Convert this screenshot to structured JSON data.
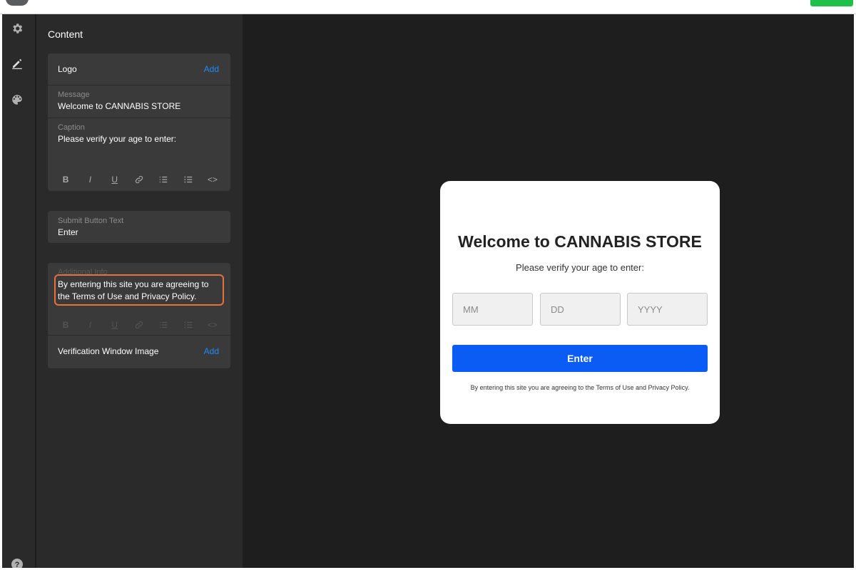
{
  "colors": {
    "accent": "#1d8cf8",
    "button": "#0a5cf5",
    "highlight": "#e8703a",
    "status_green": "#1ec04a"
  },
  "rail": {
    "icons": [
      {
        "name": "settings",
        "icon": "gear-icon"
      },
      {
        "name": "content",
        "icon": "pencil-icon"
      },
      {
        "name": "theme",
        "icon": "palette-icon"
      },
      {
        "name": "help",
        "icon": "help-icon"
      }
    ],
    "help_glyph": "?"
  },
  "panel": {
    "title": "Content",
    "logo": {
      "label": "Logo",
      "action": "Add"
    },
    "message": {
      "label": "Message",
      "value": "Welcome to CANNABIS STORE"
    },
    "caption": {
      "label": "Caption",
      "value": "Please verify your age to enter:"
    },
    "submit": {
      "label": "Submit Button Text",
      "value": "Enter"
    },
    "additional": {
      "label": "Additional Info",
      "value": "By entering this site you are agreeing to the Terms of Use and Privacy Policy."
    },
    "window_image": {
      "label": "Verification Window Image",
      "action": "Add"
    },
    "toolbar": {
      "bold": "B",
      "italic": "I",
      "underline": "U",
      "code": "<>"
    }
  },
  "preview": {
    "title": "Welcome to CANNABIS STORE",
    "caption": "Please verify your age to enter:",
    "fields": [
      {
        "placeholder": "MM"
      },
      {
        "placeholder": "DD"
      },
      {
        "placeholder": "YYYY"
      }
    ],
    "button": "Enter",
    "info": "By entering this site you are agreeing to the Terms of Use and Privacy Policy."
  }
}
